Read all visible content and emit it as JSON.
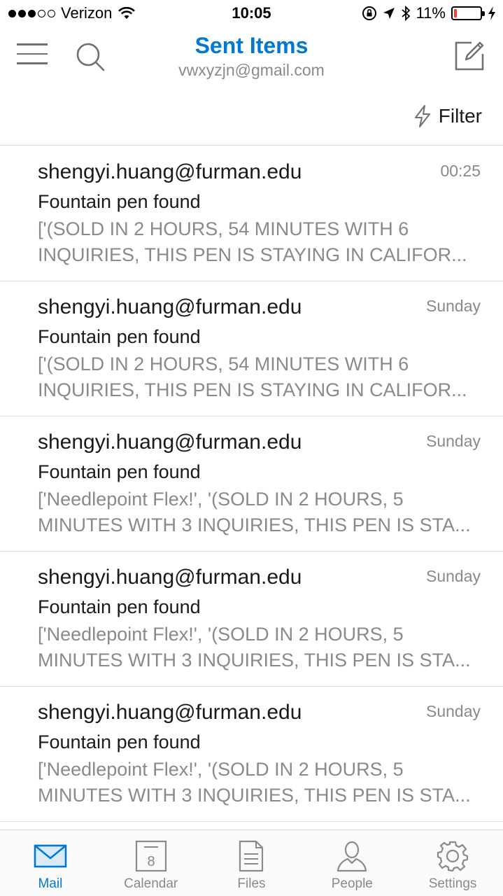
{
  "status_bar": {
    "carrier": "Verizon",
    "time": "10:05",
    "battery": "11%",
    "battery_level": 0.11
  },
  "header": {
    "title": "Sent Items",
    "account": "vwxyzjn@gmail.com"
  },
  "filter": {
    "label": "Filter"
  },
  "messages": [
    {
      "sender": "shengyi.huang@furman.edu",
      "time": "00:25",
      "subject": "Fountain pen found",
      "preview_line1": "['(SOLD IN 2 HOURS, 54 MINUTES WITH 6",
      "preview_line2": "INQUIRIES, THIS PEN IS STAYING IN CALIFOR..."
    },
    {
      "sender": "shengyi.huang@furman.edu",
      "time": "Sunday",
      "subject": "Fountain pen found",
      "preview_line1": "['(SOLD IN 2 HOURS, 54 MINUTES WITH 6",
      "preview_line2": "INQUIRIES, THIS PEN IS STAYING IN CALIFOR..."
    },
    {
      "sender": "shengyi.huang@furman.edu",
      "time": "Sunday",
      "subject": "Fountain pen found",
      "preview_line1": "['Needlepoint Flex!', '(SOLD IN 2 HOURS, 5",
      "preview_line2": "MINUTES WITH 3 INQUIRIES, THIS PEN IS STA..."
    },
    {
      "sender": "shengyi.huang@furman.edu",
      "time": "Sunday",
      "subject": "Fountain pen found",
      "preview_line1": "['Needlepoint Flex!', '(SOLD IN 2 HOURS, 5",
      "preview_line2": "MINUTES WITH 3 INQUIRIES, THIS PEN IS STA..."
    },
    {
      "sender": "shengyi.huang@furman.edu",
      "time": "Sunday",
      "subject": "Fountain pen found",
      "preview_line1": "['Needlepoint Flex!', '(SOLD IN 2 HOURS, 5",
      "preview_line2": "MINUTES WITH 3 INQUIRIES, THIS PEN IS STA..."
    }
  ],
  "tabs": [
    {
      "label": "Mail",
      "icon": "mail-icon",
      "active": true
    },
    {
      "label": "Calendar",
      "icon": "calendar-icon",
      "calendar_day": "8",
      "active": false
    },
    {
      "label": "Files",
      "icon": "files-icon",
      "active": false
    },
    {
      "label": "People",
      "icon": "people-icon",
      "active": false
    },
    {
      "label": "Settings",
      "icon": "settings-icon",
      "active": false
    }
  ],
  "colors": {
    "accent": "#0078d4",
    "secondary_text": "#8a8a8e",
    "battery_low": "#ff3b30"
  }
}
